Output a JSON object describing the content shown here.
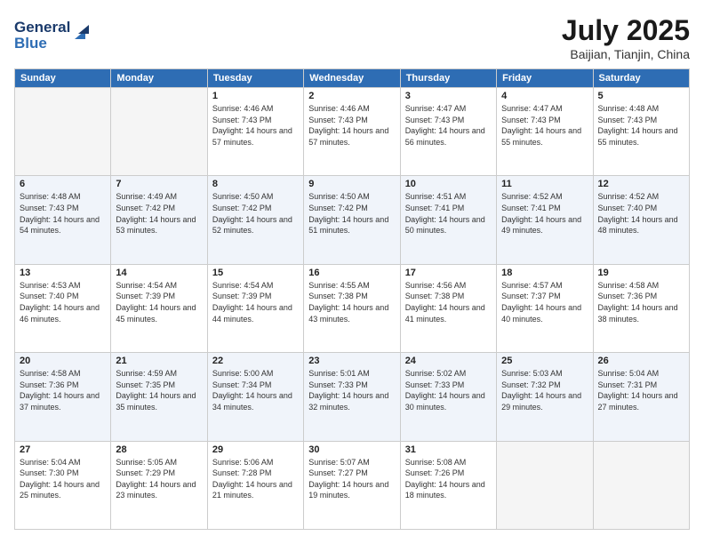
{
  "header": {
    "logo_line1": "General",
    "logo_line2": "Blue",
    "month_year": "July 2025",
    "location": "Baijian, Tianjin, China"
  },
  "weekdays": [
    "Sunday",
    "Monday",
    "Tuesday",
    "Wednesday",
    "Thursday",
    "Friday",
    "Saturday"
  ],
  "weeks": [
    [
      {
        "day": "",
        "sunrise": "",
        "sunset": "",
        "daylight": ""
      },
      {
        "day": "",
        "sunrise": "",
        "sunset": "",
        "daylight": ""
      },
      {
        "day": "1",
        "sunrise": "Sunrise: 4:46 AM",
        "sunset": "Sunset: 7:43 PM",
        "daylight": "Daylight: 14 hours and 57 minutes."
      },
      {
        "day": "2",
        "sunrise": "Sunrise: 4:46 AM",
        "sunset": "Sunset: 7:43 PM",
        "daylight": "Daylight: 14 hours and 57 minutes."
      },
      {
        "day": "3",
        "sunrise": "Sunrise: 4:47 AM",
        "sunset": "Sunset: 7:43 PM",
        "daylight": "Daylight: 14 hours and 56 minutes."
      },
      {
        "day": "4",
        "sunrise": "Sunrise: 4:47 AM",
        "sunset": "Sunset: 7:43 PM",
        "daylight": "Daylight: 14 hours and 55 minutes."
      },
      {
        "day": "5",
        "sunrise": "Sunrise: 4:48 AM",
        "sunset": "Sunset: 7:43 PM",
        "daylight": "Daylight: 14 hours and 55 minutes."
      }
    ],
    [
      {
        "day": "6",
        "sunrise": "Sunrise: 4:48 AM",
        "sunset": "Sunset: 7:43 PM",
        "daylight": "Daylight: 14 hours and 54 minutes."
      },
      {
        "day": "7",
        "sunrise": "Sunrise: 4:49 AM",
        "sunset": "Sunset: 7:42 PM",
        "daylight": "Daylight: 14 hours and 53 minutes."
      },
      {
        "day": "8",
        "sunrise": "Sunrise: 4:50 AM",
        "sunset": "Sunset: 7:42 PM",
        "daylight": "Daylight: 14 hours and 52 minutes."
      },
      {
        "day": "9",
        "sunrise": "Sunrise: 4:50 AM",
        "sunset": "Sunset: 7:42 PM",
        "daylight": "Daylight: 14 hours and 51 minutes."
      },
      {
        "day": "10",
        "sunrise": "Sunrise: 4:51 AM",
        "sunset": "Sunset: 7:41 PM",
        "daylight": "Daylight: 14 hours and 50 minutes."
      },
      {
        "day": "11",
        "sunrise": "Sunrise: 4:52 AM",
        "sunset": "Sunset: 7:41 PM",
        "daylight": "Daylight: 14 hours and 49 minutes."
      },
      {
        "day": "12",
        "sunrise": "Sunrise: 4:52 AM",
        "sunset": "Sunset: 7:40 PM",
        "daylight": "Daylight: 14 hours and 48 minutes."
      }
    ],
    [
      {
        "day": "13",
        "sunrise": "Sunrise: 4:53 AM",
        "sunset": "Sunset: 7:40 PM",
        "daylight": "Daylight: 14 hours and 46 minutes."
      },
      {
        "day": "14",
        "sunrise": "Sunrise: 4:54 AM",
        "sunset": "Sunset: 7:39 PM",
        "daylight": "Daylight: 14 hours and 45 minutes."
      },
      {
        "day": "15",
        "sunrise": "Sunrise: 4:54 AM",
        "sunset": "Sunset: 7:39 PM",
        "daylight": "Daylight: 14 hours and 44 minutes."
      },
      {
        "day": "16",
        "sunrise": "Sunrise: 4:55 AM",
        "sunset": "Sunset: 7:38 PM",
        "daylight": "Daylight: 14 hours and 43 minutes."
      },
      {
        "day": "17",
        "sunrise": "Sunrise: 4:56 AM",
        "sunset": "Sunset: 7:38 PM",
        "daylight": "Daylight: 14 hours and 41 minutes."
      },
      {
        "day": "18",
        "sunrise": "Sunrise: 4:57 AM",
        "sunset": "Sunset: 7:37 PM",
        "daylight": "Daylight: 14 hours and 40 minutes."
      },
      {
        "day": "19",
        "sunrise": "Sunrise: 4:58 AM",
        "sunset": "Sunset: 7:36 PM",
        "daylight": "Daylight: 14 hours and 38 minutes."
      }
    ],
    [
      {
        "day": "20",
        "sunrise": "Sunrise: 4:58 AM",
        "sunset": "Sunset: 7:36 PM",
        "daylight": "Daylight: 14 hours and 37 minutes."
      },
      {
        "day": "21",
        "sunrise": "Sunrise: 4:59 AM",
        "sunset": "Sunset: 7:35 PM",
        "daylight": "Daylight: 14 hours and 35 minutes."
      },
      {
        "day": "22",
        "sunrise": "Sunrise: 5:00 AM",
        "sunset": "Sunset: 7:34 PM",
        "daylight": "Daylight: 14 hours and 34 minutes."
      },
      {
        "day": "23",
        "sunrise": "Sunrise: 5:01 AM",
        "sunset": "Sunset: 7:33 PM",
        "daylight": "Daylight: 14 hours and 32 minutes."
      },
      {
        "day": "24",
        "sunrise": "Sunrise: 5:02 AM",
        "sunset": "Sunset: 7:33 PM",
        "daylight": "Daylight: 14 hours and 30 minutes."
      },
      {
        "day": "25",
        "sunrise": "Sunrise: 5:03 AM",
        "sunset": "Sunset: 7:32 PM",
        "daylight": "Daylight: 14 hours and 29 minutes."
      },
      {
        "day": "26",
        "sunrise": "Sunrise: 5:04 AM",
        "sunset": "Sunset: 7:31 PM",
        "daylight": "Daylight: 14 hours and 27 minutes."
      }
    ],
    [
      {
        "day": "27",
        "sunrise": "Sunrise: 5:04 AM",
        "sunset": "Sunset: 7:30 PM",
        "daylight": "Daylight: 14 hours and 25 minutes."
      },
      {
        "day": "28",
        "sunrise": "Sunrise: 5:05 AM",
        "sunset": "Sunset: 7:29 PM",
        "daylight": "Daylight: 14 hours and 23 minutes."
      },
      {
        "day": "29",
        "sunrise": "Sunrise: 5:06 AM",
        "sunset": "Sunset: 7:28 PM",
        "daylight": "Daylight: 14 hours and 21 minutes."
      },
      {
        "day": "30",
        "sunrise": "Sunrise: 5:07 AM",
        "sunset": "Sunset: 7:27 PM",
        "daylight": "Daylight: 14 hours and 19 minutes."
      },
      {
        "day": "31",
        "sunrise": "Sunrise: 5:08 AM",
        "sunset": "Sunset: 7:26 PM",
        "daylight": "Daylight: 14 hours and 18 minutes."
      },
      {
        "day": "",
        "sunrise": "",
        "sunset": "",
        "daylight": ""
      },
      {
        "day": "",
        "sunrise": "",
        "sunset": "",
        "daylight": ""
      }
    ]
  ]
}
